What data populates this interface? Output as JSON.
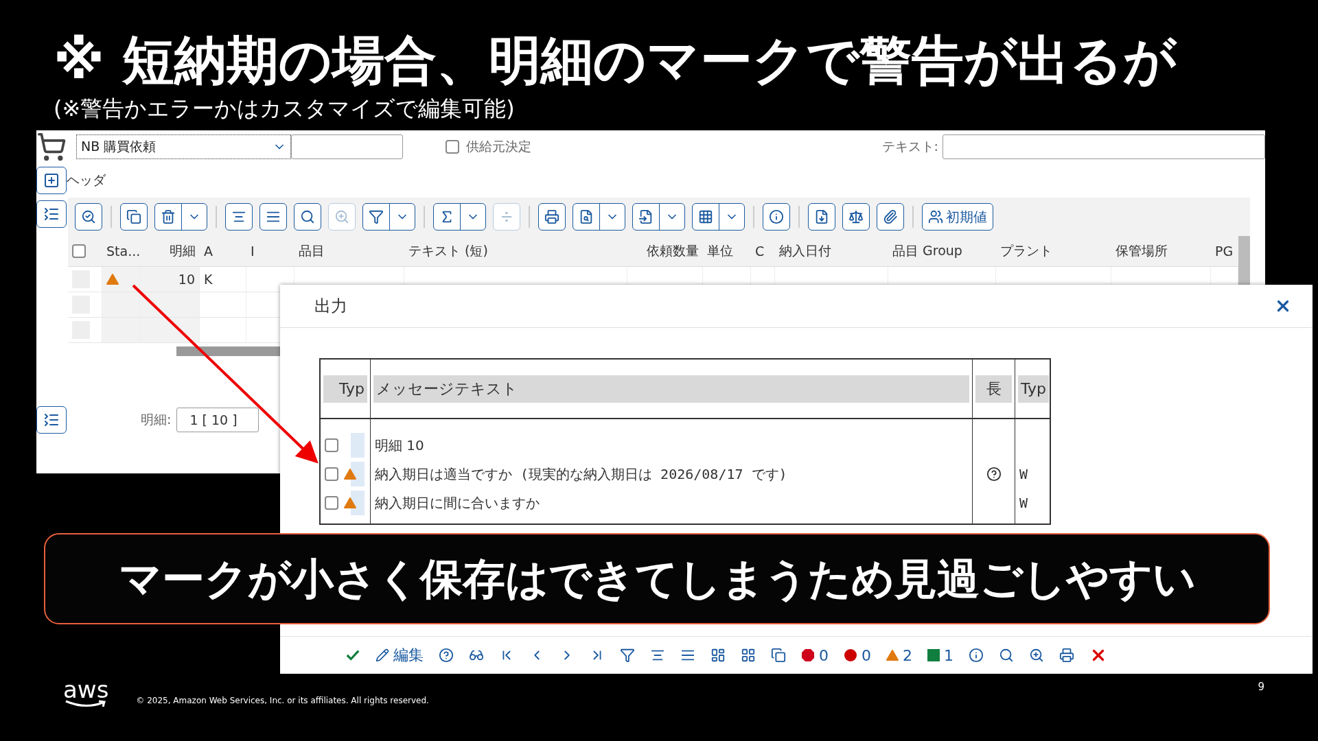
{
  "slide": {
    "title": "※ 短納期の場合、明細のマークで警告が出るが",
    "subtitle": "(※警告かエラーかはカスタマイズで編集可能)"
  },
  "sap_screen": {
    "order_type": "NB 購買依頼",
    "source_checkbox": {
      "label": "供給元決定",
      "checked": false
    },
    "text_label": "テキスト:",
    "header_label": "ヘッダ",
    "toolbar_groups": [
      [
        {
          "kind": "icon",
          "disabled": false
        }
      ],
      [
        {
          "kind": "icon",
          "disabled": false
        },
        {
          "kind": "split",
          "disabled": false
        }
      ],
      [
        {
          "kind": "icon",
          "disabled": false
        },
        {
          "kind": "icon",
          "disabled": false
        },
        {
          "kind": "icon",
          "disabled": false
        },
        {
          "kind": "icon",
          "disabled": true
        },
        {
          "kind": "split",
          "disabled": false
        }
      ],
      [
        {
          "kind": "split",
          "disabled": false
        },
        {
          "kind": "icon",
          "disabled": true
        }
      ],
      [
        {
          "kind": "icon",
          "disabled": false
        },
        {
          "kind": "split",
          "disabled": false
        },
        {
          "kind": "split",
          "disabled": false
        },
        {
          "kind": "split",
          "disabled": false
        }
      ],
      [
        {
          "kind": "icon",
          "disabled": false
        }
      ],
      [
        {
          "kind": "icon",
          "disabled": false
        },
        {
          "kind": "icon",
          "disabled": false
        },
        {
          "kind": "icon",
          "disabled": false
        }
      ],
      [
        {
          "kind": "text",
          "disabled": false,
          "label": "初期値"
        }
      ]
    ],
    "columns": [
      "Sta...",
      "明細",
      "A",
      "I",
      "品目",
      "テキスト (短)",
      "依頼数量",
      "単位",
      "C",
      "納入日付",
      "品目 Group",
      "プラント",
      "保管場所",
      "PG"
    ],
    "select_all_checked": false,
    "rows": [
      {
        "warning": true,
        "item": "10",
        "a": "K"
      },
      {
        "warning": false
      },
      {
        "warning": false
      }
    ],
    "item_label": "明細:",
    "item_value": "1 [ 10 ]"
  },
  "dialog": {
    "title": "出力",
    "columns": [
      "Typ",
      "メッセージテキスト",
      "長",
      "Typ"
    ],
    "messages": [
      {
        "kind": "header",
        "checked": false,
        "text": "明細 10",
        "has_long_text": false
      },
      {
        "kind": "warning",
        "checked": false,
        "text": "納入期日は適当ですか (現実的な納入期日は 2026/08/17 です)",
        "has_long_text": true,
        "type": "W"
      },
      {
        "kind": "warning",
        "checked": false,
        "text": "納入期日に間に合いますか",
        "has_long_text": false,
        "type": "W"
      }
    ],
    "edit_label": "編集",
    "counts": [
      {
        "kind": "stop",
        "count": "0"
      },
      {
        "kind": "error",
        "count": "0"
      },
      {
        "kind": "warning",
        "count": "2"
      },
      {
        "kind": "success",
        "count": "1"
      }
    ]
  },
  "callout": "マークが小さく保存はできてしまうため見過ごしやすい",
  "footer": {
    "logo": "aws",
    "copyright": "© 2025, Amazon Web Services, Inc. or its affiliates. All rights reserved.",
    "page": "9"
  }
}
